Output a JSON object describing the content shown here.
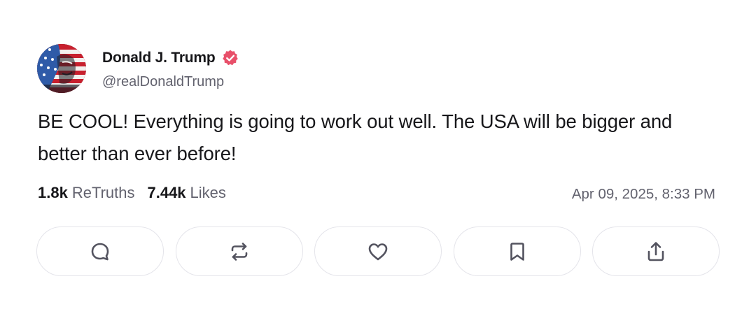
{
  "author": {
    "display_name": "Donald J. Trump",
    "handle": "@realDonaldTrump",
    "verified_color": "#e8506a"
  },
  "post": {
    "text": "BE COOL! Everything is going to work out well. The USA will be bigger and better than ever before!",
    "timestamp": "Apr 09, 2025, 8:33 PM"
  },
  "stats": {
    "retruths_count": "1.8k",
    "retruths_label": "ReTruths",
    "likes_count": "7.44k",
    "likes_label": "Likes"
  },
  "actions": [
    {
      "icon": "reply-icon"
    },
    {
      "icon": "retruth-icon"
    },
    {
      "icon": "like-icon"
    },
    {
      "icon": "bookmark-icon"
    },
    {
      "icon": "share-icon"
    }
  ]
}
